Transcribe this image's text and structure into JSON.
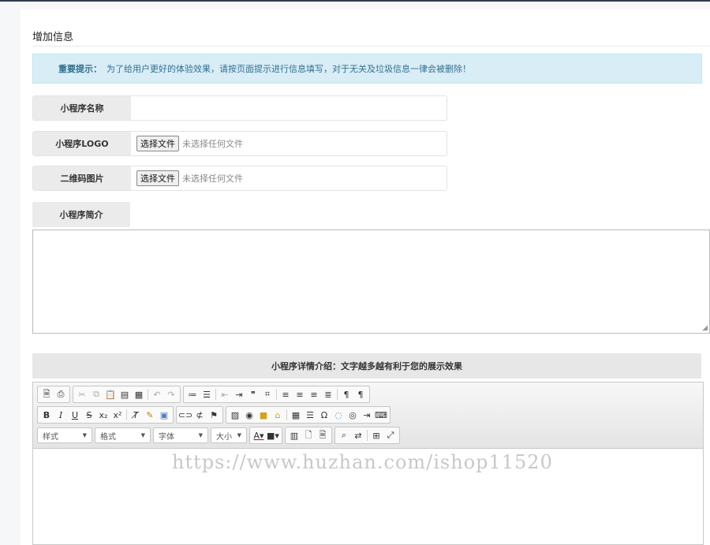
{
  "page": {
    "title": "增加信息"
  },
  "alert": {
    "label": "重要提示：",
    "text": "为了给用户更好的体验效果，请按页面提示进行信息填写，对于无关及垃圾信息一律会被删除！"
  },
  "form": {
    "name_label": "小程序名称",
    "name_value": "",
    "logo_label": "小程序LOGO",
    "qrcode_label": "二维码图片",
    "file_button": "选择文件",
    "file_none": "未选择任何文件",
    "intro_label": "小程序简介",
    "intro_value": ""
  },
  "detail": {
    "header": "小程序详情介绍：文字越多越有利于您的展示效果"
  },
  "editor": {
    "combos": {
      "style": "样式",
      "format": "格式",
      "font": "字体",
      "size": "大小"
    },
    "row1_icons": [
      "source-icon",
      "print-icon",
      "cut-icon",
      "copy-icon",
      "paste-icon",
      "paste-text-icon",
      "paste-word-icon",
      "undo-icon",
      "redo-icon",
      "numbered-list-icon",
      "bulleted-list-icon",
      "outdent-icon",
      "indent-icon",
      "blockquote-icon",
      "creatediv-icon",
      "align-left-icon",
      "align-center-icon",
      "align-right-icon",
      "align-justify-icon",
      "ltr-icon",
      "rtl-icon"
    ],
    "row2_icons": [
      "bold-icon",
      "italic-icon",
      "underline-icon",
      "strike-icon",
      "subscript-icon",
      "superscript-icon",
      "remove-format-icon",
      "copy-format-icon",
      "templates-icon",
      "link-icon",
      "unlink-icon",
      "anchor-icon",
      "image-icon",
      "flash-icon",
      "iframe-icon",
      "upload-icon",
      "table-icon",
      "hr-icon",
      "special-char-icon",
      "smiley-icon",
      "pagebreak-icon",
      "showblocks-icon",
      "code-icon"
    ],
    "watermark": "https://www.huzhan.com/ishop11520",
    "content": ""
  }
}
